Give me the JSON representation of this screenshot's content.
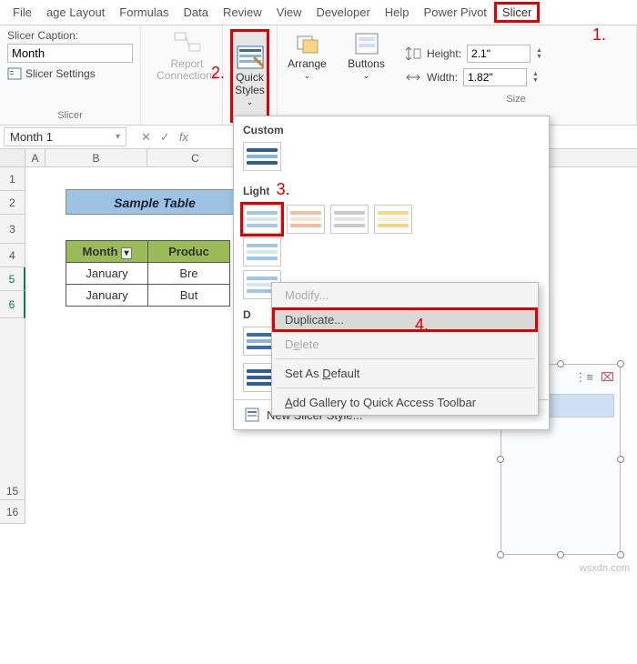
{
  "tabs": {
    "file": "File",
    "pl": "age Layout",
    "formulas": "Formulas",
    "data": "Data",
    "review": "Review",
    "view": "View",
    "dev": "Developer",
    "help": "Help",
    "pp": "Power Pivot",
    "slicer": "Slicer"
  },
  "ribbon": {
    "caption_label": "Slicer Caption:",
    "caption_value": "Month",
    "settings": "Slicer Settings",
    "report_conn": "Report Connections",
    "quick_styles": "Quick Styles",
    "arrange": "Arrange",
    "buttons": "Buttons",
    "height_label": "Height:",
    "height_value": "2.1\"",
    "width_label": "Width:",
    "width_value": "1.82\"",
    "group_slicer": "Slicer",
    "group_size": "Size"
  },
  "annot": {
    "a1": "1.",
    "a2": "2.",
    "a3": "3.",
    "a4": "4."
  },
  "namebox": "Month 1",
  "columns": {
    "A": "A",
    "B": "B",
    "C": "C"
  },
  "rows": [
    "1",
    "2",
    "3",
    "4",
    "5",
    "6",
    "15",
    "16"
  ],
  "table": {
    "title": "Sample Table",
    "h1": "Month",
    "h2": "Produc",
    "r1c1": "January",
    "r1c2": "Bre",
    "r2c1": "January",
    "r2c2": "But"
  },
  "gallery": {
    "custom": "Custom",
    "light": "Light",
    "dark_initial": "D",
    "new_style": "New Slicer Style..."
  },
  "ctx": {
    "modify": "Modify...",
    "duplicate": "Duplicate...",
    "delete": "Delete",
    "default": "Set As Default",
    "add": "Add Gallery to Quick Access Toolbar"
  },
  "watermark": "wsxdn.com",
  "chart_data": null
}
